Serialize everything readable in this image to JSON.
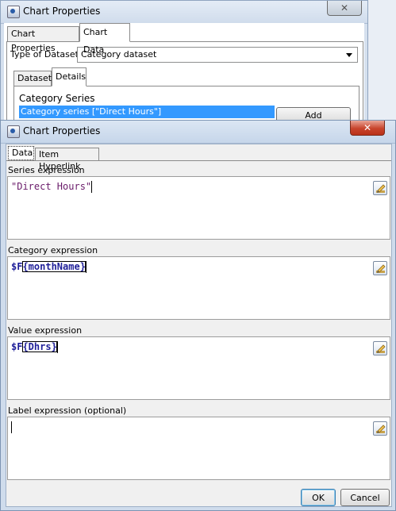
{
  "background_window": {
    "title": "Chart Properties",
    "tabs": [
      "Chart Properties",
      "Chart Data"
    ],
    "dataset_type_label": "Type of Dataset",
    "dataset_type_value": "Category dataset",
    "sub_tabs": [
      "Dataset",
      "Details"
    ],
    "category_series_label": "Category Series",
    "category_series_item": "Category series [\"Direct Hours\"]",
    "add_button": "Add"
  },
  "dialog": {
    "title": "Chart Properties",
    "tabs": [
      "Data",
      "Item Hyperlink"
    ],
    "series_expression_label": "Series expression",
    "series_expression_value": "\"Direct Hours\"",
    "category_expression_label": "Category expression",
    "category_expression_prefix": "$F",
    "category_expression_field": "{monthName}",
    "value_expression_label": "Value expression",
    "value_expression_prefix": "$F",
    "value_expression_field": "{Dhrs}",
    "label_expression_label": "Label expression (optional)",
    "label_expression_value": "",
    "ok_button": "OK",
    "cancel_button": "Cancel"
  },
  "colors": {
    "selection": "#3399ff",
    "string_literal": "#6a1b6a",
    "field_ref": "#1f1f99",
    "close_red": "#c8442c"
  }
}
